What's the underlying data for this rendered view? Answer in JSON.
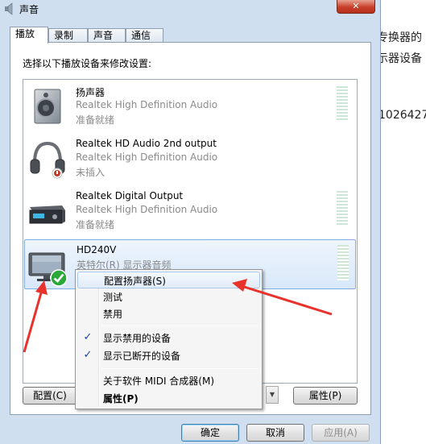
{
  "background": {
    "fragments": [
      "专换器的",
      "示器设备",
      "1026427"
    ]
  },
  "window": {
    "title": "声音",
    "close_glyph": "✕"
  },
  "tabs": [
    {
      "label": "播放"
    },
    {
      "label": "录制"
    },
    {
      "label": "声音"
    },
    {
      "label": "通信"
    }
  ],
  "panel": {
    "instruction": "选择以下播放设备来修改设置:"
  },
  "devices": [
    {
      "name": "扬声器",
      "desc": "Realtek High Definition Audio",
      "status": "准备就绪",
      "icon": "speaker-icon"
    },
    {
      "name": "Realtek HD Audio 2nd output",
      "desc": "Realtek High Definition Audio",
      "status": "未插入",
      "icon": "headphones-icon"
    },
    {
      "name": "Realtek Digital Output",
      "desc": "Realtek High Definition Audio",
      "status": "准备就绪",
      "icon": "digital-output-icon"
    },
    {
      "name": "HD240V",
      "desc": "英特尔(R) 显示器音频",
      "status": "",
      "icon": "monitor-icon",
      "default_badge": "green-check-icon"
    }
  ],
  "buttons": {
    "configure": "配置(C)",
    "properties": "属性(P)",
    "ok": "确定",
    "cancel": "取消",
    "apply": "应用(A)"
  },
  "context_menu": {
    "items": [
      {
        "label": "配置扬声器(S)",
        "checked": false,
        "bold": false,
        "hover": true
      },
      {
        "label": "测试",
        "checked": false,
        "bold": false
      },
      {
        "label": "禁用",
        "checked": false,
        "bold": false
      },
      {
        "label": "显示禁用的设备",
        "checked": true,
        "bold": false
      },
      {
        "label": "显示已断开的设备",
        "checked": true,
        "bold": false
      },
      {
        "label": "关于软件 MIDI 合成器(M)",
        "checked": false,
        "bold": false
      },
      {
        "label": "属性(P)",
        "checked": false,
        "bold": true
      }
    ],
    "check_glyph": "✓"
  },
  "colors": {
    "annotation_arrow": "#e8322b",
    "selection_border": "#84acdd",
    "window_frame": "#cfdff0"
  }
}
